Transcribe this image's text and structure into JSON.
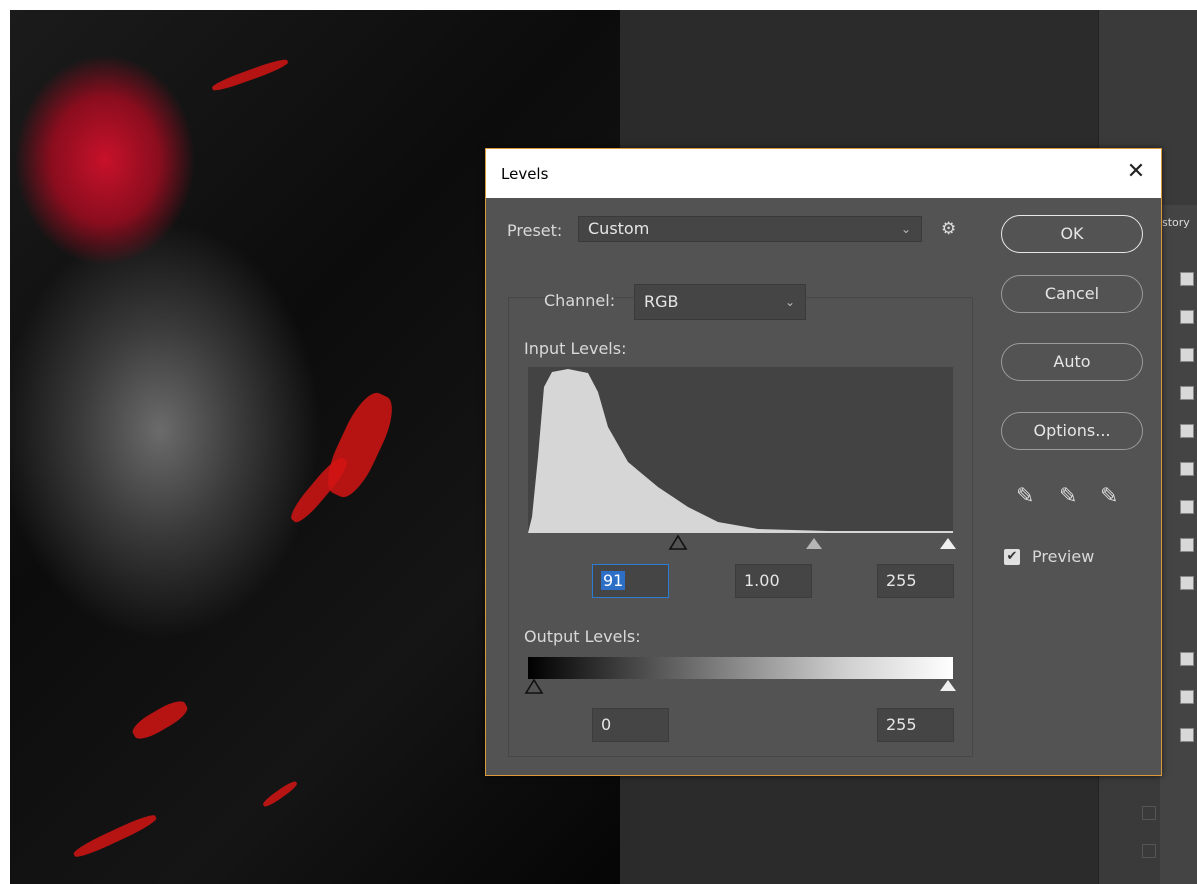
{
  "dialog": {
    "title": "Levels",
    "close_glyph": "✕"
  },
  "preset": {
    "label": "Preset:",
    "value": "Custom"
  },
  "channel": {
    "label": "Channel:",
    "value": "RGB"
  },
  "input_levels": {
    "label": "Input Levels:",
    "black": "91",
    "gamma": "1.00",
    "white": "255"
  },
  "output_levels": {
    "label": "Output Levels:",
    "black": "0",
    "white": "255"
  },
  "buttons": {
    "ok": "OK",
    "cancel": "Cancel",
    "auto": "Auto",
    "options": "Options..."
  },
  "preview": {
    "label": "Preview",
    "checked": true
  },
  "history_panel": {
    "tab_label": "story"
  },
  "icons": {
    "gear": "gear-icon",
    "eyedroppers": [
      "black-eyedropper-icon",
      "gray-eyedropper-icon",
      "white-eyedropper-icon"
    ]
  },
  "colors": {
    "dialog_bg": "#535353",
    "dialog_border": "#d89a3a",
    "selection": "#2d6fc7"
  }
}
